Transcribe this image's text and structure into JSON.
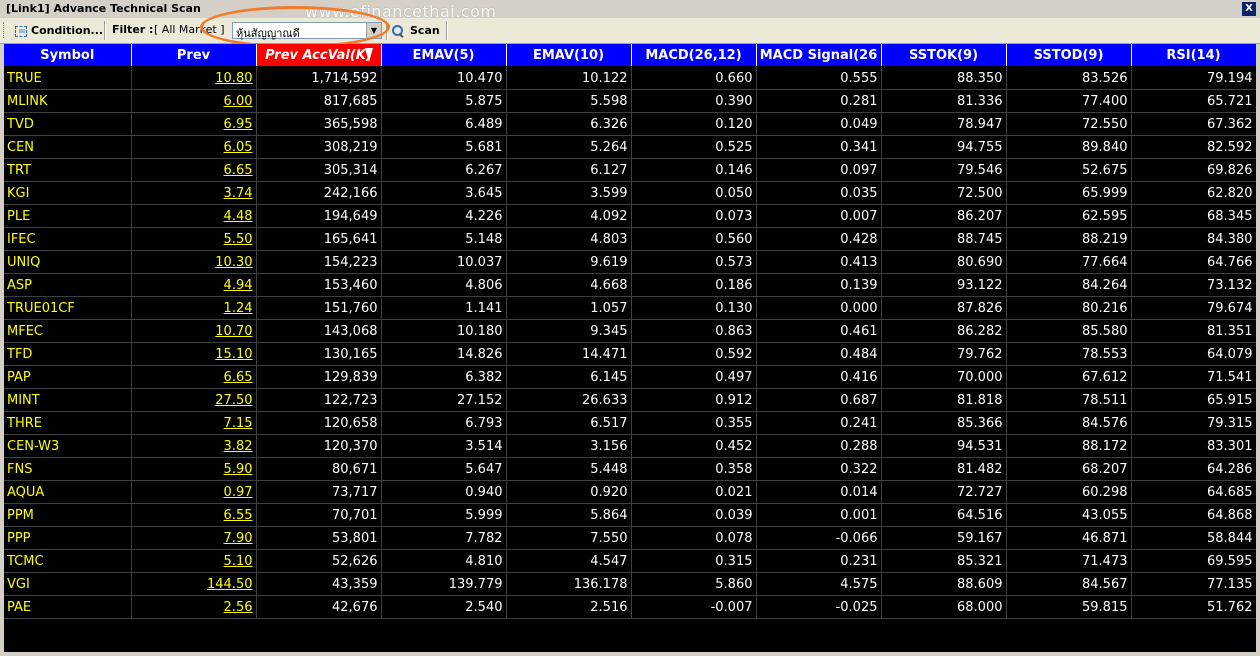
{
  "window": {
    "title": "[Link1] Advance Technical Scan",
    "watermark": "www.efinancethai.com",
    "close_label": "X"
  },
  "toolbar": {
    "condition_label": "Condition...",
    "filter_label": "Filter :",
    "filter_value": "[ All Market ]",
    "select_value": "หุ้นสัญญาณดี",
    "scan_label": "Scan"
  },
  "highlight_color": "#f07c2a",
  "table": {
    "sorted_column": "Prev AccVal(K)",
    "columns": [
      "Symbol",
      "Prev",
      "Prev AccVal(K)",
      "EMAV(5)",
      "EMAV(10)",
      "MACD(26,12)",
      "MACD Signal(26",
      "SSTOK(9)",
      "SSTOD(9)",
      "RSI(14)"
    ],
    "rows": [
      [
        "TRUE",
        "10.80",
        "1,714,592",
        "10.470",
        "10.122",
        "0.660",
        "0.555",
        "88.350",
        "83.526",
        "79.194"
      ],
      [
        "MLINK",
        "6.00",
        "817,685",
        "5.875",
        "5.598",
        "0.390",
        "0.281",
        "81.336",
        "77.400",
        "65.721"
      ],
      [
        "TVD",
        "6.95",
        "365,598",
        "6.489",
        "6.326",
        "0.120",
        "0.049",
        "78.947",
        "72.550",
        "67.362"
      ],
      [
        "CEN",
        "6.05",
        "308,219",
        "5.681",
        "5.264",
        "0.525",
        "0.341",
        "94.755",
        "89.840",
        "82.592"
      ],
      [
        "TRT",
        "6.65",
        "305,314",
        "6.267",
        "6.127",
        "0.146",
        "0.097",
        "79.546",
        "52.675",
        "69.826"
      ],
      [
        "KGI",
        "3.74",
        "242,166",
        "3.645",
        "3.599",
        "0.050",
        "0.035",
        "72.500",
        "65.999",
        "62.820"
      ],
      [
        "PLE",
        "4.48",
        "194,649",
        "4.226",
        "4.092",
        "0.073",
        "0.007",
        "86.207",
        "62.595",
        "68.345"
      ],
      [
        "IFEC",
        "5.50",
        "165,641",
        "5.148",
        "4.803",
        "0.560",
        "0.428",
        "88.745",
        "88.219",
        "84.380"
      ],
      [
        "UNIQ",
        "10.30",
        "154,223",
        "10.037",
        "9.619",
        "0.573",
        "0.413",
        "80.690",
        "77.664",
        "64.766"
      ],
      [
        "ASP",
        "4.94",
        "153,460",
        "4.806",
        "4.668",
        "0.186",
        "0.139",
        "93.122",
        "84.264",
        "73.132"
      ],
      [
        "TRUE01CF",
        "1.24",
        "151,760",
        "1.141",
        "1.057",
        "0.130",
        "0.000",
        "87.826",
        "80.216",
        "79.674"
      ],
      [
        "MFEC",
        "10.70",
        "143,068",
        "10.180",
        "9.345",
        "0.863",
        "0.461",
        "86.282",
        "85.580",
        "81.351"
      ],
      [
        "TFD",
        "15.10",
        "130,165",
        "14.826",
        "14.471",
        "0.592",
        "0.484",
        "79.762",
        "78.553",
        "64.079"
      ],
      [
        "PAP",
        "6.65",
        "129,839",
        "6.382",
        "6.145",
        "0.497",
        "0.416",
        "70.000",
        "67.612",
        "71.541"
      ],
      [
        "MINT",
        "27.50",
        "122,723",
        "27.152",
        "26.633",
        "0.912",
        "0.687",
        "81.818",
        "78.511",
        "65.915"
      ],
      [
        "THRE",
        "7.15",
        "120,658",
        "6.793",
        "6.517",
        "0.355",
        "0.241",
        "85.366",
        "84.576",
        "79.315"
      ],
      [
        "CEN-W3",
        "3.82",
        "120,370",
        "3.514",
        "3.156",
        "0.452",
        "0.288",
        "94.531",
        "88.172",
        "83.301"
      ],
      [
        "FNS",
        "5.90",
        "80,671",
        "5.647",
        "5.448",
        "0.358",
        "0.322",
        "81.482",
        "68.207",
        "64.286"
      ],
      [
        "AQUA",
        "0.97",
        "73,717",
        "0.940",
        "0.920",
        "0.021",
        "0.014",
        "72.727",
        "60.298",
        "64.685"
      ],
      [
        "PPM",
        "6.55",
        "70,701",
        "5.999",
        "5.864",
        "0.039",
        "0.001",
        "64.516",
        "43.055",
        "64.868"
      ],
      [
        "PPP",
        "7.90",
        "53,801",
        "7.782",
        "7.550",
        "0.078",
        "-0.066",
        "59.167",
        "46.871",
        "58.844"
      ],
      [
        "TCMC",
        "5.10",
        "52,626",
        "4.810",
        "4.547",
        "0.315",
        "0.231",
        "85.321",
        "71.473",
        "69.595"
      ],
      [
        "VGI",
        "144.50",
        "43,359",
        "139.779",
        "136.178",
        "5.860",
        "4.575",
        "88.609",
        "84.567",
        "77.135"
      ],
      [
        "PAE",
        "2.56",
        "42,676",
        "2.540",
        "2.516",
        "-0.007",
        "-0.025",
        "68.000",
        "59.815",
        "51.762"
      ]
    ]
  }
}
